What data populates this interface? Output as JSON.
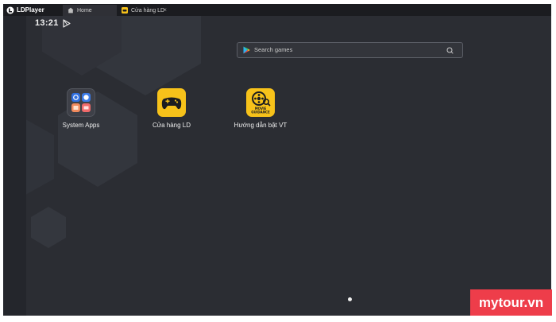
{
  "window": {
    "app_name": "LDPlayer",
    "tabs": [
      {
        "label": "Home",
        "icon": "home-icon",
        "active": true
      },
      {
        "label": "Cửa hàng LD",
        "icon": "ld-store-icon",
        "active": false,
        "close": "×"
      }
    ]
  },
  "status_bar": {
    "time": "13:21",
    "notification_icon": "play-store-icon"
  },
  "search": {
    "placeholder": "Search games",
    "icon_left": "google-play-icon",
    "icon_right": "search-icon"
  },
  "apps": [
    {
      "label": "System Apps",
      "icon": "system-apps-folder-icon"
    },
    {
      "label": "Cửa hàng LD",
      "icon": "gamepad-icon"
    },
    {
      "label": "Hướng dẫn bật VT",
      "icon": "movie-guidance-icon",
      "icon_text_1": "MOVIE",
      "icon_text_2": "GUIDANCE"
    }
  ],
  "page_indicator": {
    "pages": 1,
    "current": 1
  },
  "watermark": {
    "text": "mytour.vn"
  },
  "colors": {
    "screen_bg": "#2b2d33",
    "titlebar_bg": "#1b1c20",
    "ld_yellow": "#f7c21a",
    "watermark_red": "#ee3d4a"
  }
}
